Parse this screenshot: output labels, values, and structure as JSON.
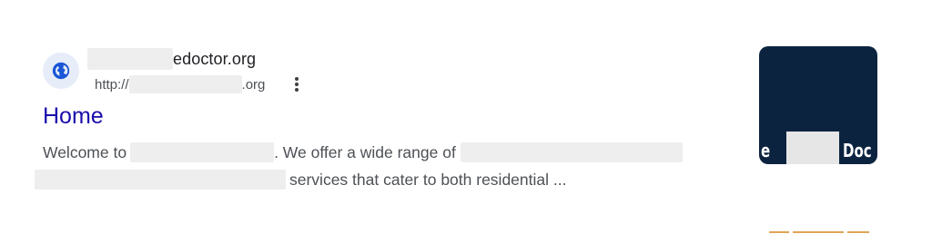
{
  "result": {
    "favicon_icon": "globe-icon",
    "site_name_suffix": "edoctor.org",
    "url_prefix": "http://",
    "url_suffix": ".org",
    "menu_icon": "more-vert-icon",
    "title": "Home",
    "snippet": {
      "line1_start": "Welcome to",
      "line1_mid": ". We offer a wide range of",
      "line2_end": "services that cater to both residential ..."
    },
    "thumbnail": {
      "text_left": "e",
      "text_right": "Doc"
    }
  },
  "colors": {
    "title_link": "#1a0dab",
    "body_text": "#4d5156",
    "thumbnail_bg": "#0c2340",
    "favicon_bg": "#e6ecf8",
    "favicon_globe": "#1a56d6",
    "redaction": "#eeeeee"
  }
}
